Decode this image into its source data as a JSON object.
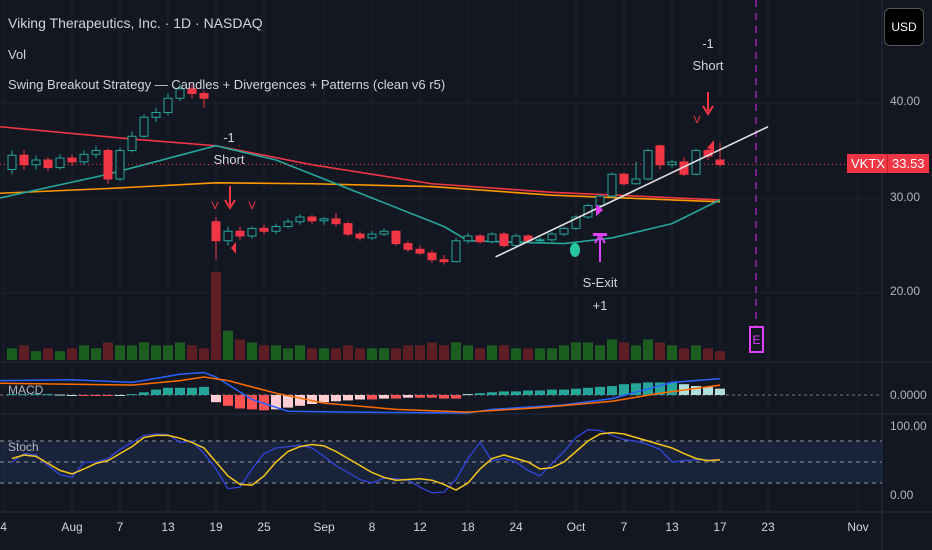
{
  "header": {
    "title": "Viking Therapeutics, Inc. · 1D · NASDAQ",
    "vol": "Vol",
    "strategy": "Swing Breakout Strategy — Candles + Divergences + Patterns (clean v6 r5)",
    "currency": "USD"
  },
  "price_tag": {
    "symbol": "VKTX",
    "price": "33.53"
  },
  "annotations": {
    "short1": [
      "-1",
      "Short"
    ],
    "short2": [
      "-1",
      "Short"
    ],
    "exit": [
      "S-Exit",
      "+1"
    ],
    "earnings": "E",
    "v": "V"
  },
  "panes": {
    "macd_label": "MACD",
    "stoch_label": "Stoch"
  },
  "chart_data": {
    "type": "candlestick",
    "title": "Viking Therapeutics, Inc. · 1D · NASDAQ",
    "price_ticks": [
      "40.00",
      "30.00",
      "20.00"
    ],
    "price_tick_values": [
      40,
      30,
      20
    ],
    "macd_ticks": [
      "0.0000"
    ],
    "stoch_ticks": [
      "100.00",
      "0.00"
    ],
    "x_ticks": [
      {
        "i": -0.7,
        "label": "4"
      },
      {
        "i": 5,
        "label": "Aug"
      },
      {
        "i": 9,
        "label": "7"
      },
      {
        "i": 13,
        "label": "13"
      },
      {
        "i": 17,
        "label": "19"
      },
      {
        "i": 21,
        "label": "25"
      },
      {
        "i": 26,
        "label": "Sep"
      },
      {
        "i": 30,
        "label": "8"
      },
      {
        "i": 34,
        "label": "12"
      },
      {
        "i": 38,
        "label": "18"
      },
      {
        "i": 42,
        "label": "24"
      },
      {
        "i": 47,
        "label": "Oct"
      },
      {
        "i": 51,
        "label": "7"
      },
      {
        "i": 55,
        "label": "13"
      },
      {
        "i": 59,
        "label": "17"
      },
      {
        "i": 63,
        "label": "23"
      },
      {
        "i": 70.5,
        "label": "Nov"
      }
    ],
    "ohlc": [
      [
        33,
        35,
        32.5,
        34.5
      ],
      [
        34.5,
        35,
        33,
        33.5
      ],
      [
        33.5,
        34.5,
        33,
        34
      ],
      [
        34,
        34.3,
        32.8,
        33.2
      ],
      [
        33.2,
        34.6,
        33,
        34.2
      ],
      [
        34.2,
        34.6,
        33.4,
        33.8
      ],
      [
        33.8,
        35,
        33.5,
        34.6
      ],
      [
        34.6,
        35.5,
        34.2,
        35
      ],
      [
        35,
        35.2,
        31.5,
        32
      ],
      [
        32,
        35.3,
        31.8,
        35
      ],
      [
        35,
        37,
        34.8,
        36.5
      ],
      [
        36.5,
        38.8,
        36.3,
        38.5
      ],
      [
        38.5,
        39.5,
        38,
        39
      ],
      [
        39,
        41,
        38.7,
        40.5
      ],
      [
        40.5,
        42,
        40.2,
        41.5
      ],
      [
        41.5,
        42,
        40.5,
        41
      ],
      [
        41,
        41.3,
        39.5,
        40.5
      ],
      [
        27.5,
        28,
        23.5,
        25.5
      ],
      [
        25.5,
        27,
        25,
        26.5
      ],
      [
        26.5,
        27,
        25.6,
        26
      ],
      [
        26,
        27,
        25.7,
        26.8
      ],
      [
        26.8,
        27.2,
        26.2,
        26.5
      ],
      [
        26.5,
        27.3,
        26.2,
        27
      ],
      [
        27,
        27.8,
        26.8,
        27.5
      ],
      [
        27.5,
        28.3,
        27.2,
        28
      ],
      [
        28,
        28.2,
        27.3,
        27.6
      ],
      [
        27.6,
        28,
        27.2,
        27.8
      ],
      [
        27.8,
        28.4,
        27,
        27.3
      ],
      [
        27.3,
        27.5,
        26,
        26.2
      ],
      [
        26.2,
        26.5,
        25.5,
        25.8
      ],
      [
        25.8,
        26.5,
        25.6,
        26.2
      ],
      [
        26.2,
        26.8,
        26,
        26.5
      ],
      [
        26.5,
        26.6,
        25,
        25.2
      ],
      [
        25.2,
        25.5,
        24.3,
        24.6
      ],
      [
        24.6,
        25,
        24,
        24.2
      ],
      [
        24.2,
        24.5,
        23.2,
        23.5
      ],
      [
        23.5,
        24,
        23,
        23.3
      ],
      [
        23.3,
        25.8,
        23.2,
        25.5
      ],
      [
        25.5,
        26.3,
        25.2,
        26
      ],
      [
        26,
        26.2,
        25.2,
        25.4
      ],
      [
        25.4,
        26.4,
        25.2,
        26.2
      ],
      [
        26.2,
        26.4,
        24.8,
        25
      ],
      [
        25,
        26.2,
        24.9,
        26
      ],
      [
        26,
        26.2,
        25.3,
        25.5
      ],
      [
        25.5,
        25.9,
        25.3,
        25.6
      ],
      [
        25.6,
        26.4,
        25.4,
        26.2
      ],
      [
        26.2,
        27,
        26,
        26.8
      ],
      [
        26.8,
        28.2,
        26.6,
        28
      ],
      [
        28,
        29.4,
        27.8,
        29.2
      ],
      [
        29.2,
        30.4,
        29,
        30.2
      ],
      [
        30.2,
        32.7,
        30,
        32.5
      ],
      [
        32.5,
        32.7,
        31.3,
        31.5
      ],
      [
        31.5,
        33.8,
        31.4,
        32
      ],
      [
        32,
        35.2,
        31.9,
        35
      ],
      [
        35.5,
        35.6,
        33,
        33.5
      ],
      [
        33.5,
        34,
        33.2,
        33.8
      ],
      [
        33.8,
        34.3,
        32.3,
        32.5
      ],
      [
        32.5,
        35.2,
        32.4,
        35
      ],
      [
        35,
        35.4,
        34,
        34.4
      ],
      [
        34,
        35.8,
        33.3,
        33.53
      ]
    ],
    "volume": [
      4,
      5,
      3,
      4,
      3,
      4,
      5,
      4,
      6,
      5,
      5,
      6,
      5,
      5,
      6,
      5,
      4,
      30,
      10,
      7,
      6,
      5,
      5,
      4,
      5,
      4,
      4,
      4,
      5,
      4,
      4,
      4,
      4,
      5,
      5,
      6,
      5,
      6,
      5,
      4,
      5,
      5,
      4,
      4,
      4,
      4,
      5,
      6,
      6,
      5,
      7,
      6,
      5,
      7,
      6,
      5,
      4,
      5,
      4,
      3
    ],
    "ma_series": [
      {
        "name": "MA long",
        "color": "#f23645",
        "points": [
          [
            -1,
            37.5
          ],
          [
            10,
            36.2
          ],
          [
            17,
            35.5
          ],
          [
            25,
            33.5
          ],
          [
            35,
            31.5
          ],
          [
            45,
            30.6
          ],
          [
            59,
            29.8
          ]
        ]
      },
      {
        "name": "MA mid",
        "color": "#ff9800",
        "points": [
          [
            -1,
            30.5
          ],
          [
            8,
            31
          ],
          [
            17,
            31.6
          ],
          [
            25,
            31.5
          ],
          [
            35,
            31.2
          ],
          [
            45,
            30.3
          ],
          [
            59,
            29.6
          ]
        ]
      },
      {
        "name": "MA short",
        "color": "#26a69a",
        "points": [
          [
            -1,
            30
          ],
          [
            8,
            32.5
          ],
          [
            17,
            35.5
          ],
          [
            22,
            34
          ],
          [
            30,
            30
          ],
          [
            36,
            27
          ],
          [
            38,
            25.5
          ],
          [
            46,
            25.2
          ],
          [
            50,
            25.8
          ],
          [
            55,
            27.3
          ],
          [
            59,
            29.8
          ]
        ]
      }
    ],
    "trendline": [
      [
        40.3,
        23.8
      ],
      [
        63,
        37.5
      ]
    ],
    "last_price": 33.53,
    "macd": {
      "hist": [
        0.1,
        0.1,
        0.1,
        0.1,
        0.05,
        0,
        -0.05,
        -0.05,
        -0.1,
        0,
        0.1,
        0.3,
        0.6,
        0.8,
        0.8,
        0.8,
        0.9,
        -0.8,
        -1.2,
        -1.5,
        -1.6,
        -1.7,
        -1.6,
        -1.4,
        -1.2,
        -1,
        -0.8,
        -0.7,
        -0.6,
        -0.5,
        -0.5,
        -0.4,
        -0.4,
        -0.3,
        -0.3,
        -0.3,
        -0.4,
        -0.4,
        0.1,
        0.2,
        0.3,
        0.4,
        0.4,
        0.5,
        0.5,
        0.6,
        0.6,
        0.7,
        0.8,
        0.9,
        1.0,
        1.2,
        1.3,
        1.4,
        1.4,
        1.4,
        1.2,
        1.0,
        0.9,
        0.7
      ],
      "macd": [
        [
          -1,
          1.6
        ],
        [
          5,
          1.7
        ],
        [
          10,
          1.4
        ],
        [
          14,
          2.3
        ],
        [
          16,
          2.5
        ],
        [
          17,
          2.0
        ],
        [
          20,
          -0.5
        ],
        [
          23,
          -1.8
        ],
        [
          28,
          -1.9
        ],
        [
          38,
          -2.0
        ],
        [
          40,
          -1.6
        ],
        [
          46,
          -1.1
        ],
        [
          50,
          -0.4
        ],
        [
          55,
          1.4
        ],
        [
          59,
          1.8
        ]
      ],
      "signal": [
        [
          -1,
          1.3
        ],
        [
          5,
          1.2
        ],
        [
          10,
          1.1
        ],
        [
          14,
          1.6
        ],
        [
          16,
          2.0
        ],
        [
          18,
          1.6
        ],
        [
          22,
          0.2
        ],
        [
          26,
          -0.9
        ],
        [
          32,
          -1.6
        ],
        [
          38,
          -1.9
        ],
        [
          44,
          -1.4
        ],
        [
          50,
          -0.7
        ],
        [
          54,
          0.2
        ],
        [
          59,
          1.1
        ]
      ]
    },
    "stoch": {
      "k": [
        50,
        62,
        60,
        45,
        32,
        28,
        50,
        50,
        55,
        68,
        78,
        88,
        90,
        89,
        78,
        80,
        62,
        40,
        12,
        14,
        40,
        62,
        70,
        72,
        74,
        70,
        58,
        45,
        35,
        25,
        20,
        27,
        26,
        24,
        14,
        6,
        7,
        25,
        55,
        78,
        52,
        55,
        50,
        38,
        30,
        48,
        65,
        85,
        96,
        95,
        88,
        82,
        80,
        75,
        68,
        50,
        52,
        53,
        53,
        53
      ],
      "d": [
        55,
        60,
        58,
        48,
        38,
        33,
        40,
        48,
        52,
        62,
        72,
        85,
        88,
        88,
        84,
        78,
        70,
        50,
        30,
        18,
        17,
        30,
        50,
        65,
        72,
        75,
        73,
        65,
        55,
        45,
        35,
        28,
        24,
        25,
        26,
        24,
        18,
        10,
        20,
        40,
        55,
        60,
        55,
        50,
        40,
        42,
        50,
        65,
        80,
        90,
        92,
        90,
        85,
        80,
        75,
        70,
        62,
        55,
        52,
        53
      ],
      "bands": [
        80,
        50,
        20
      ],
      "range": [
        0,
        100
      ]
    },
    "colors": {
      "up": "#26a69a",
      "down": "#f23645",
      "macd": "#2962ff",
      "signal": "#ff6d00",
      "stoch_k": "#3344dd",
      "stoch_d": "#f5c518",
      "event": "#e040fb"
    }
  }
}
